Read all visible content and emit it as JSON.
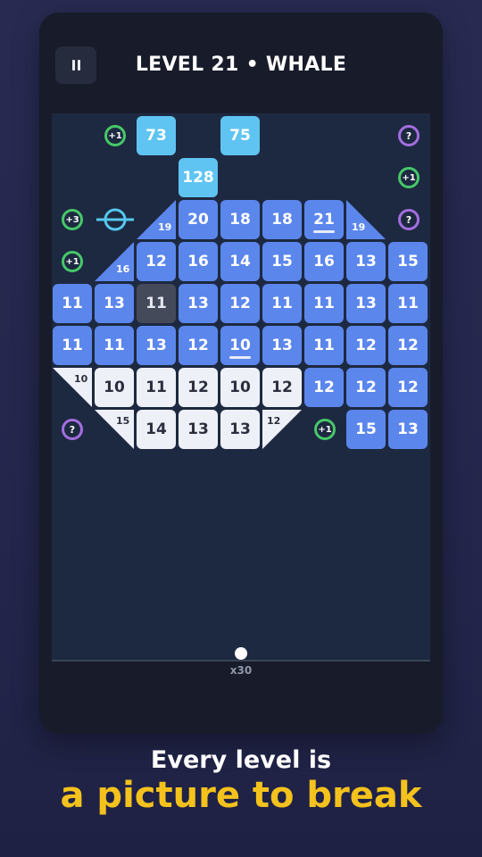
{
  "header": {
    "title": "LEVEL 21 • WHALE"
  },
  "blocks": {
    "r0": [
      "73",
      "75"
    ],
    "r1": [
      "128"
    ],
    "r2": [
      "20",
      "18",
      "18",
      "21"
    ],
    "r2_tri": [
      "19",
      "19"
    ],
    "r3": [
      "12",
      "16",
      "14",
      "15",
      "16",
      "13",
      "15"
    ],
    "r3_tri": [
      "16"
    ],
    "r4": [
      "11",
      "13",
      "11",
      "13",
      "12",
      "11",
      "11",
      "13",
      "11"
    ],
    "r5": [
      "11",
      "11",
      "13",
      "12",
      "10",
      "13",
      "11",
      "12",
      "12"
    ],
    "r6": [
      "10",
      "11",
      "12",
      "10",
      "12",
      "12",
      "12",
      "12"
    ],
    "r6_tri": [
      "10"
    ],
    "r7": [
      "14",
      "13",
      "13",
      "15",
      "13"
    ],
    "r7_tri": [
      "15",
      "12"
    ]
  },
  "powerups": {
    "plus1": "+1",
    "plus3": "+3",
    "mystery": "?"
  },
  "balls": {
    "count": "x30"
  },
  "caption": {
    "line1": "Every level is",
    "line2": "a picture to break"
  },
  "colors": {
    "block_blue": "#5b86ec",
    "block_white": "#eef0f8",
    "block_cyan": "#5fc4f2",
    "block_hit": "#454a5a",
    "powerup_green": "#46c869",
    "powerup_purple": "#a36ee0",
    "laser_cyan": "#55c8f0",
    "caption_yellow": "#f4c21c"
  },
  "icons": [
    "pause-icon",
    "horizontal-laser-icon",
    "ball-icon"
  ]
}
